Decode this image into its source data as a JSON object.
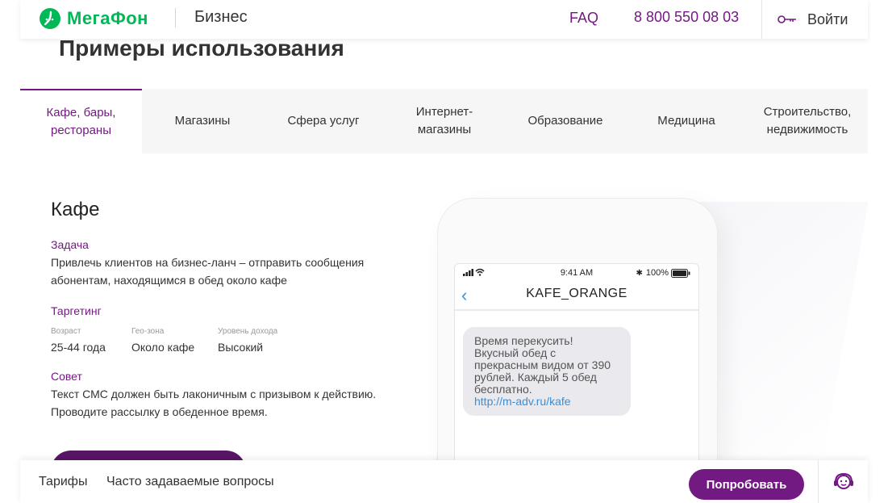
{
  "header": {
    "logo_text": "МегаФон",
    "section": "Бизнес",
    "faq": "FAQ",
    "phone": "8 800 550 08 03",
    "login": "Войти",
    "brand_color": "#00b956",
    "accent_color": "#731982"
  },
  "page": {
    "title": "Примеры использования"
  },
  "tabs": [
    {
      "label": "Кафе, бары, рестораны",
      "active": true
    },
    {
      "label": "Магазины"
    },
    {
      "label": "Сфера услуг"
    },
    {
      "label": "Интернет-магазины"
    },
    {
      "label": "Образование"
    },
    {
      "label": "Медицина"
    },
    {
      "label": "Строительство, недвижимость"
    }
  ],
  "case": {
    "title": "Кафе",
    "task_label": "Задача",
    "task_text": "Привлечь клиентов на бизнес-ланч – отправить сообщения абонентам, находящимся в обед около кафе",
    "targeting_label": "Таргетинг",
    "targeting": [
      {
        "label": "Возраст",
        "value": "25-44 года"
      },
      {
        "label": "Гео-зона",
        "value": "Около кафе"
      },
      {
        "label": "Уровень дохода",
        "value": "Высокий"
      }
    ],
    "advice_label": "Совет",
    "advice_text": "Текст СМС должен быть лаконичным с призывом к действию. Проводите рассылку в обеденное время."
  },
  "phone_mock": {
    "time": "9:41 AM",
    "battery": "100%",
    "sender": "KAFE_ORANGE",
    "message": "Время перекусить! Вкусный обед с прекрасным видом от 390 рублей. Каждый 5 обед бесплатно.",
    "link": "http://m-adv.ru/kafe"
  },
  "bottom_bar": {
    "tariffs": "Тарифы",
    "faq": "Часто задаваемые вопросы",
    "try_button": "Попробовать"
  }
}
